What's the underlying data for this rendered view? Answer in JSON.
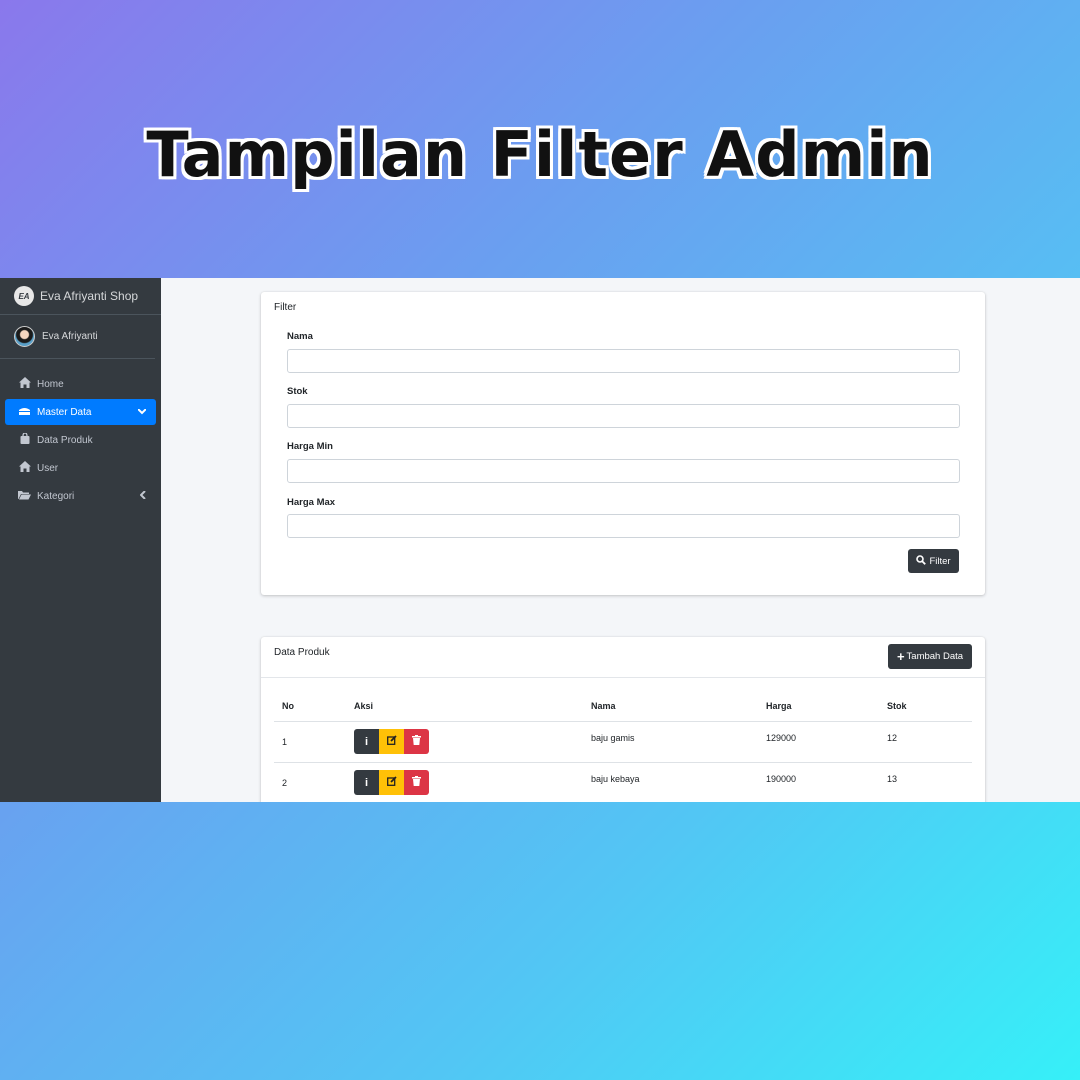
{
  "banner": {
    "title": "Tampilan Filter Admin"
  },
  "sidebar": {
    "brand": "Eva Afriyanti Shop",
    "brand_logo": "EA",
    "user": "Eva Afriyanti",
    "items": [
      {
        "label": "Home",
        "icon": "home-icon"
      },
      {
        "label": "Master Data",
        "icon": "database-icon",
        "active": true
      },
      {
        "label": "Data Produk",
        "icon": "bag-icon"
      },
      {
        "label": "User",
        "icon": "home-icon"
      },
      {
        "label": "Kategori",
        "icon": "folder-icon"
      }
    ]
  },
  "filter": {
    "title": "Filter",
    "fields": [
      {
        "label": "Nama",
        "value": ""
      },
      {
        "label": "Stok",
        "value": ""
      },
      {
        "label": "Harga Min",
        "value": ""
      },
      {
        "label": "Harga Max",
        "value": ""
      }
    ],
    "button": "Filter"
  },
  "products": {
    "title": "Data Produk",
    "add_button": "Tambah Data",
    "columns": [
      "No",
      "Aksi",
      "Nama",
      "Harga",
      "Stok"
    ],
    "rows": [
      {
        "no": "1",
        "nama": "baju gamis",
        "harga": "129000",
        "stok": "12"
      },
      {
        "no": "2",
        "nama": "baju kebaya",
        "harga": "190000",
        "stok": "13"
      }
    ]
  },
  "colors": {
    "active": "#007bff",
    "sidebar": "#343a40",
    "edit": "#ffc107",
    "delete": "#dc3545"
  }
}
